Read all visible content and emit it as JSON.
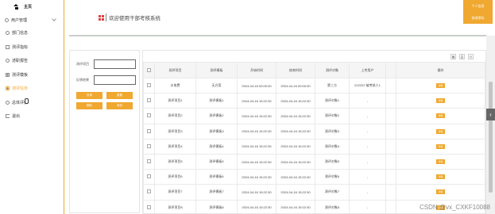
{
  "colors": {
    "accent": "#f0a830",
    "sidebar_border": "#f0a830",
    "logo": "#e04040"
  },
  "sidebar": {
    "home": "主页",
    "user_mgmt": "用户管理",
    "items": [
      {
        "label": "部门信息",
        "icon": "circle-icon"
      },
      {
        "label": "测评指标",
        "icon": "square-icon"
      },
      {
        "label": "述职报告",
        "icon": "circle-icon"
      },
      {
        "label": "测评模板",
        "icon": "grid-icon"
      },
      {
        "label": "测评任务",
        "icon": "grid-icon"
      },
      {
        "label": "总体评价",
        "icon": "circle-icon"
      }
    ],
    "logout": "退出"
  },
  "header": {
    "title": "欢迎使用干部考核系统",
    "btn_personal": "个人信息",
    "btn_password": "修改密码"
  },
  "search": {
    "label1": "测评项目",
    "label2": "反馈结果",
    "buttons": [
      "查询",
      "重置",
      "删除",
      "添加"
    ]
  },
  "table": {
    "columns": [
      "测评项目",
      "测评模板",
      "开始时间",
      "结束时间",
      "测评对象",
      "上传用户",
      "",
      "操作"
    ],
    "rows": [
      [
        "水电费",
        "无方案",
        "2024-04-16 00:00:00",
        "2024-04-16 00:00:00",
        "第三方",
        "222222 被考核人1",
        "",
        "详情"
      ],
      [
        "测评项目1",
        "测评模板1",
        "2024-04-16 15:22:30",
        "2024-04-16 15:22:30",
        "测评对象1",
        "-",
        "",
        "详情"
      ],
      [
        "测评项目2",
        "测评模板2",
        "2024-04-16 15:22:30",
        "2024-04-16 15:22:30",
        "测评对象2",
        "-",
        "",
        "详情"
      ],
      [
        "测评项目3",
        "测评模板3",
        "2024-04-16 15:22:30",
        "2024-04-16 15:22:30",
        "测评对象3",
        "-",
        "",
        "详情"
      ],
      [
        "测评项目4",
        "测评模板4",
        "2024-04-16 15:22:30",
        "2024-04-16 15:22:30",
        "测评对象4",
        "-",
        "",
        "详情"
      ],
      [
        "测评项目5",
        "测评模板5",
        "2024-04-16 15:22:30",
        "2024-04-16 15:22:30",
        "测评对象5",
        "-",
        "",
        "详情"
      ],
      [
        "测评项目6",
        "测评模板6",
        "2024-04-16 15:22:30",
        "2024-04-16 15:22:30",
        "测评对象6",
        "-",
        "",
        "详情"
      ],
      [
        "测评项目7",
        "测评模板7",
        "2024-04-16 15:22:30",
        "2024-04-16 15:22:30",
        "测评对象7",
        "-",
        "",
        "详情"
      ],
      [
        "测评项目8",
        "测评模板8",
        "2024-04-16 15:22:30",
        "2024-04-16 15:22:30",
        "测评对象8",
        "-",
        "",
        "详情"
      ]
    ]
  },
  "watermark": "CSDN @vx_CXKF10088"
}
